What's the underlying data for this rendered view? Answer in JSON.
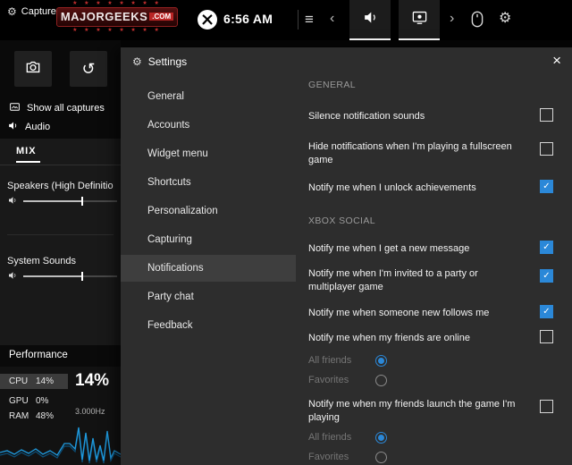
{
  "colors": {
    "accent_blue": "#2b88d8",
    "panel_bg": "#2d2d2d",
    "chart_line": "#1f9ade"
  },
  "icons": {
    "gear": "⚙",
    "menu": "≡",
    "chevron_left": "‹",
    "chevron_right": "›",
    "undo": "↺",
    "close": "×",
    "check": "✓"
  },
  "watermark": {
    "stars_top": "★ ★ ★ ★ ★ ★ ★ ★",
    "title": "MAJORGEEKS",
    "domain": ".COM",
    "stars_bottom": "★ ★ ★ ★ ★ ★ ★ ★"
  },
  "topbar": {
    "time": "6:56 AM"
  },
  "capture": {
    "title": "Capture",
    "show_all_label": "Show all captures"
  },
  "audio": {
    "title": "Audio",
    "mix_tab": "MIX",
    "channels": [
      {
        "name": "Speakers (High Definitio"
      },
      {
        "name": "System Sounds"
      }
    ]
  },
  "performance": {
    "title": "Performance",
    "stats": [
      {
        "label": "CPU",
        "value": "14%"
      },
      {
        "label": "GPU",
        "value": "0%"
      },
      {
        "label": "RAM",
        "value": "48%"
      }
    ],
    "cpu_big": "14%",
    "frequency": "3.000Hz"
  },
  "settings": {
    "title": "Settings",
    "nav": [
      "General",
      "Accounts",
      "Widget menu",
      "Shortcuts",
      "Personalization",
      "Capturing",
      "Notifications",
      "Party chat",
      "Feedback"
    ],
    "selected_nav": "Notifications",
    "general": {
      "header": "GENERAL",
      "items": [
        {
          "label": "Silence notification sounds",
          "checked": false
        },
        {
          "label": "Hide notifications when I'm playing a fullscreen game",
          "checked": false
        },
        {
          "label": "Notify me when I unlock achievements",
          "checked": true
        }
      ]
    },
    "xbox_social": {
      "header": "XBOX SOCIAL",
      "items": [
        {
          "label": "Notify me when I get a new message",
          "checked": true
        },
        {
          "label": "Notify me when I'm invited to a party or multiplayer game",
          "checked": true
        },
        {
          "label": "Notify me when someone new follows me",
          "checked": true
        },
        {
          "label": "Notify me when my friends are online",
          "checked": false
        },
        {
          "label": "Notify me when my friends launch the game I'm playing",
          "checked": false
        }
      ],
      "radio_groups": [
        {
          "options": [
            {
              "label": "All friends",
              "selected": true
            },
            {
              "label": "Favorites",
              "selected": false
            }
          ]
        },
        {
          "options": [
            {
              "label": "All friends",
              "selected": true
            },
            {
              "label": "Favorites",
              "selected": false
            }
          ]
        }
      ]
    }
  }
}
